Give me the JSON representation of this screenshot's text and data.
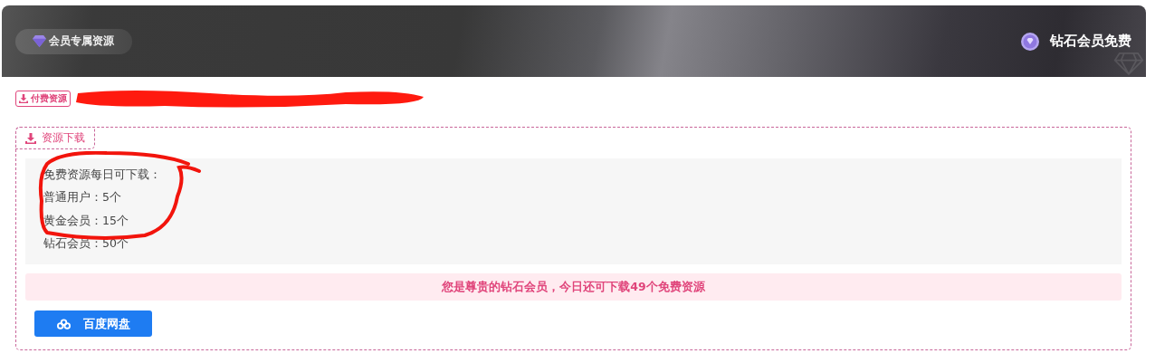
{
  "banner": {
    "badge": "会员专属资源",
    "vip_label": "钻石会员免费"
  },
  "paid_tag": "付费资源",
  "download_box": {
    "legend": "资源下载",
    "limits": [
      "免费资源每日可下载：",
      "普通用户：5个",
      "黄金会员：15个",
      "钻石会员：50个"
    ],
    "notice": "您是尊贵的钻石会员，今日还可下载49个免费资源",
    "button": "百度网盘"
  }
}
